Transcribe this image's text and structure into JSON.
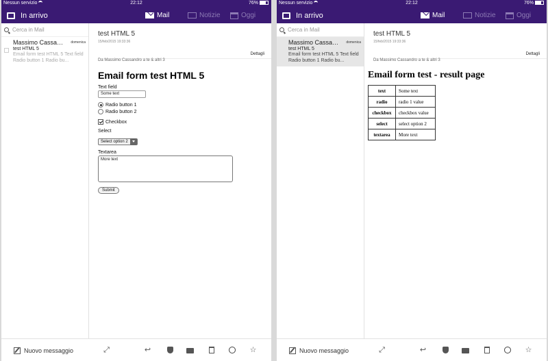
{
  "status_bar": {
    "carrier": "Nessun servizio",
    "time": "22:12",
    "battery": "76%"
  },
  "nav": {
    "inbox_label": "In arrivo",
    "tabs": [
      {
        "label": "Mail",
        "icon": "mail-icon",
        "active": true
      },
      {
        "label": "Notizie",
        "icon": "news-icon",
        "active": false
      },
      {
        "label": "Oggi",
        "icon": "calendar-icon",
        "active": false
      }
    ]
  },
  "search": {
    "placeholder": "Cerca in Mail"
  },
  "message_list": [
    {
      "sender": "Massimo Cassandro",
      "date": "domenica",
      "subject": "test HTML 5",
      "preview": "Email form test HTML 5 Text field Radio button 1 Radio bu..."
    }
  ],
  "message": {
    "subject": "test HTML 5",
    "datetime": "15/feb/2015 19:33:36",
    "from_line": "Da Massimo Cassandro a te & altri 3",
    "details_label": "Dettagli"
  },
  "form": {
    "title": "Email form test HTML 5",
    "text_label": "Text field",
    "text_value": "Some text",
    "radio1": "Radio button 1",
    "radio2": "Radio button 2",
    "checkbox": "Checkbox",
    "select_label": "Select",
    "select_value": "Select option 2",
    "textarea_label": "Textarea",
    "textarea_value": "More text",
    "submit": "Submit"
  },
  "result": {
    "title": "Email form test - result page",
    "rows": [
      {
        "key": "text",
        "value": "Some text"
      },
      {
        "key": "radio",
        "value": "radio 1 value"
      },
      {
        "key": "checkbox",
        "value": "checkbox value"
      },
      {
        "key": "select",
        "value": "select option 2"
      },
      {
        "key": "textarea",
        "value": "More text"
      }
    ]
  },
  "toolbar": {
    "new_message": "Nuovo messaggio",
    "icons": [
      "expand-icon",
      "reply-icon",
      "spam-shield-icon",
      "move-folder-icon",
      "trash-icon",
      "mark-unread-icon",
      "star-icon"
    ]
  },
  "colors": {
    "header_bg": "#3a1a73",
    "inactive_tab": "#8d7bb4",
    "selected_row": "#e6e6e6"
  }
}
